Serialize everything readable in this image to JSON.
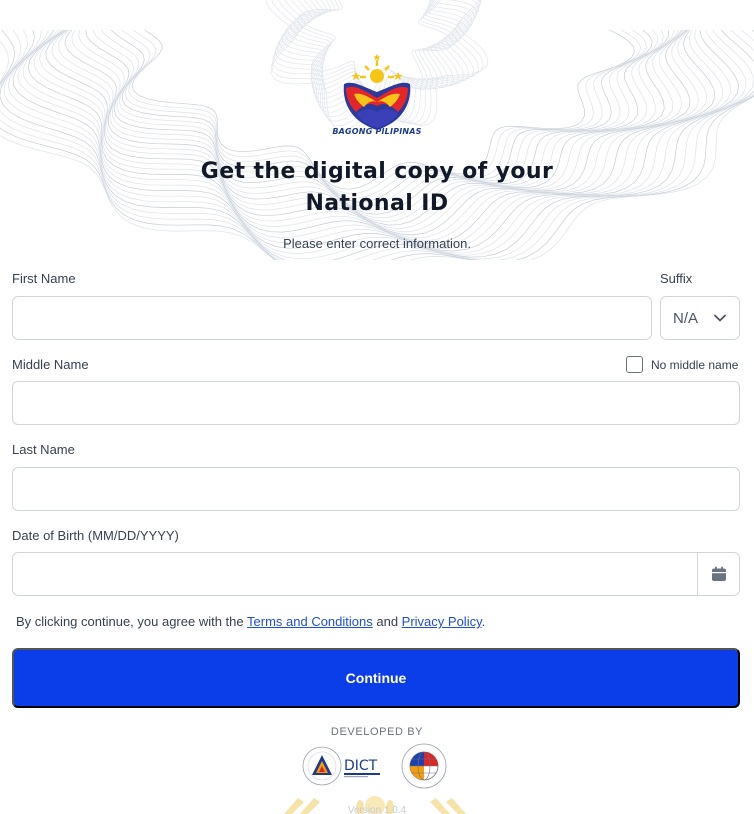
{
  "header": {
    "logo_text": "BAGONG PILIPINAS",
    "title_line1": "Get the digital copy of your",
    "title_line2": "National ID",
    "subtitle": "Please enter correct information."
  },
  "form": {
    "first_name": {
      "label": "First Name",
      "value": "",
      "placeholder": ""
    },
    "suffix": {
      "label": "Suffix",
      "value": "N/A"
    },
    "middle_name": {
      "label": "Middle Name",
      "value": "",
      "placeholder": ""
    },
    "no_middle_name": {
      "label": "No middle name",
      "checked": false
    },
    "last_name": {
      "label": "Last Name",
      "value": "",
      "placeholder": ""
    },
    "dob": {
      "label": "Date of Birth (MM/DD/YYYY)",
      "value": "",
      "placeholder": ""
    }
  },
  "terms": {
    "prefix": "By clicking continue, you agree with the ",
    "terms_link": "Terms and Conditions",
    "middle": " and ",
    "privacy_link": "Privacy Policy",
    "suffix": "."
  },
  "actions": {
    "continue_label": "Continue"
  },
  "footer": {
    "developed_by": "DEVELOPED BY",
    "dict_logo_text": "DICT",
    "version": "Version 1.0.4"
  },
  "colors": {
    "primary": "#0b3ee8",
    "link": "#1d4ed8",
    "border": "#d1d5db"
  },
  "icons": {
    "suffix_dropdown": "chevron-down-icon",
    "dob_picker": "calendar-icon"
  }
}
